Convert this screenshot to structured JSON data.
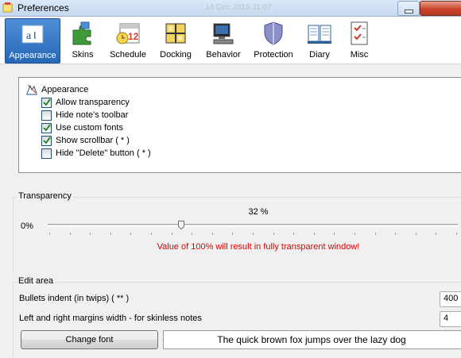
{
  "window": {
    "title": "Preferences",
    "ghost_date": "14 Dec 2015 11:07"
  },
  "toolbar": {
    "items": [
      {
        "label": "Appearance",
        "icon": "appearance-icon"
      },
      {
        "label": "Skins",
        "icon": "puzzle-icon"
      },
      {
        "label": "Schedule",
        "icon": "calendar-clock-icon"
      },
      {
        "label": "Docking",
        "icon": "docking-icon"
      },
      {
        "label": "Behavior",
        "icon": "computer-icon"
      },
      {
        "label": "Protection",
        "icon": "shield-icon"
      },
      {
        "label": "Diary",
        "icon": "book-icon"
      },
      {
        "label": "Misc",
        "icon": "checklist-icon"
      }
    ],
    "active": "Appearance"
  },
  "appearance": {
    "root_label": "Appearance",
    "options": [
      {
        "label": "Allow transparency",
        "checked": true
      },
      {
        "label": "Hide note's toolbar",
        "checked": false
      },
      {
        "label": "Use custom fonts",
        "checked": true
      },
      {
        "label": "Show scrollbar ( * )",
        "checked": true
      },
      {
        "label": "Hide \"Delete\" button ( * )",
        "checked": false
      }
    ]
  },
  "transparency": {
    "legend": "Transparency",
    "value_label": "32 %",
    "min_label": "0%",
    "value_fraction": 0.32,
    "warning": "Value of 100% will result in fully transparent window!"
  },
  "edit_area": {
    "legend": "Edit area",
    "bullets_label": "Bullets indent (in twips) ( ** )",
    "bullets_value": "400",
    "margins_label": "Left and right margins width - for skinless notes",
    "margins_value": "4",
    "change_font_label": "Change font",
    "font_preview": "The quick brown fox jumps over the lazy dog"
  },
  "colors": {
    "accent": "#2f74c8",
    "warning": "#e00000"
  }
}
